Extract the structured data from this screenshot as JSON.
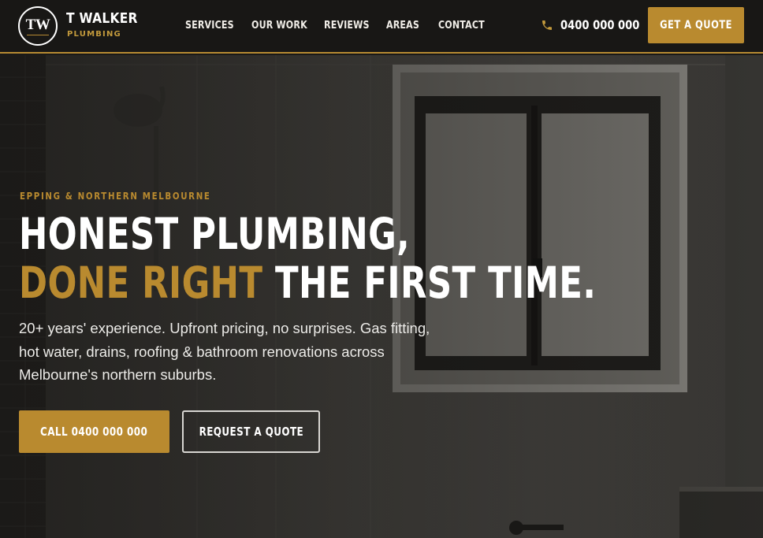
{
  "brand": {
    "monogram": "TW",
    "name": "T WALKER",
    "tagline": "PLUMBING"
  },
  "nav": {
    "items": [
      {
        "label": "SERVICES"
      },
      {
        "label": "OUR WORK"
      },
      {
        "label": "REVIEWS"
      },
      {
        "label": "AREAS"
      },
      {
        "label": "CONTACT"
      }
    ]
  },
  "header": {
    "phone_icon": "phone-icon",
    "phone": "0400 000 000",
    "quote_label": "GET A QUOTE"
  },
  "hero": {
    "eyebrow": "EPPING & NORTHERN MELBOURNE",
    "headline_line1": "HONEST PLUMBING,",
    "headline_accent": "DONE RIGHT",
    "headline_rest": " THE FIRST TIME.",
    "lead_line1": "20+ years' experience. Upfront pricing, no surprises. Gas fitting,",
    "lead_line2": "hot water, drains, roofing & bathroom renovations across",
    "lead_line3": "Melbourne's northern suburbs.",
    "cta_primary": "CALL 0400 000 000",
    "cta_secondary": "REQUEST A QUOTE"
  },
  "colors": {
    "accent": "#b98a2f",
    "header_bg": "#181715",
    "text_light": "#ffffff"
  }
}
